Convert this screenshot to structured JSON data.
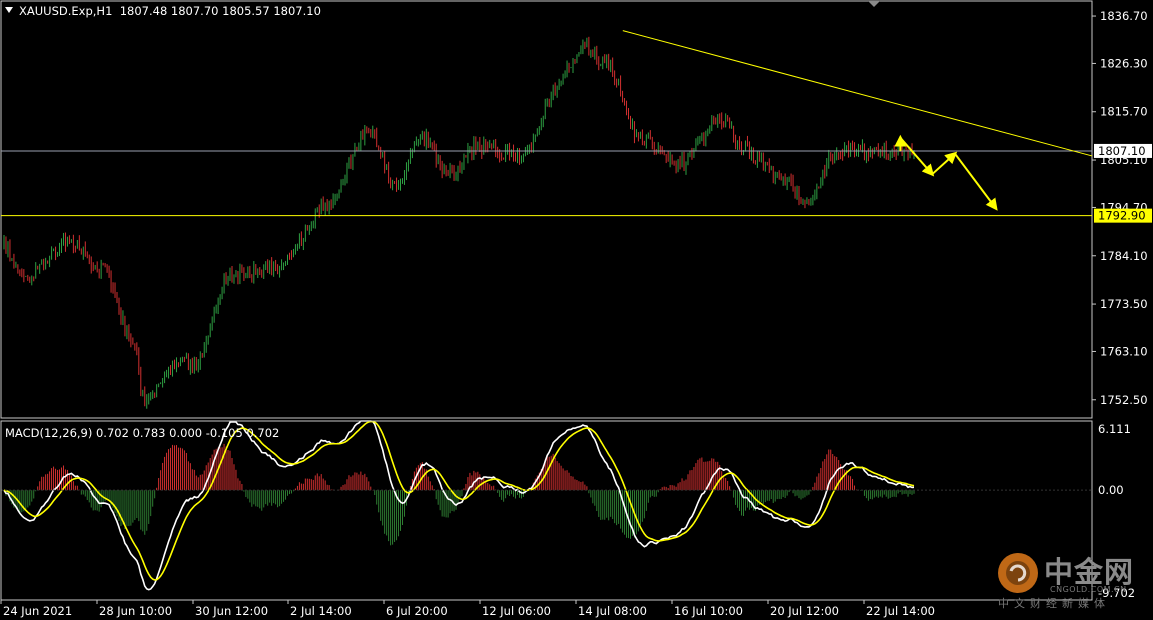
{
  "header": {
    "symbol": "XAUUSD.Exp,H1",
    "ohlc": "1807.48 1807.70 1805.57 1807.10"
  },
  "macd": {
    "label": "MACD(12,26,9) 0.702 0.783 0.000 -0.105 0.702",
    "axis_top": "6.111",
    "axis_zero": "0.00",
    "axis_bottom": "-9.702"
  },
  "watermark": {
    "main": "中金网",
    "url": "CNGOLD.COM.CN",
    "sub": "中文财经新媒体"
  },
  "colors": {
    "background": "#000000",
    "bull": "#2ea043",
    "bear": "#d23030",
    "line": "#ffff00",
    "current_price": "#9aa0b0",
    "macd_line": "#ffffff",
    "signal_line": "#ffff00",
    "hist_pos": "#d23030",
    "hist_neg": "#2e7d32"
  },
  "chart_data": [
    {
      "type": "candlestick",
      "symbol": "XAUUSD.Exp",
      "timeframe": "H1",
      "ylim": [
        1748.5,
        1840.0
      ],
      "y_ticks": [
        "1836.70",
        "1826.30",
        "1815.70",
        "1805.10",
        "1794.70",
        "1784.10",
        "1773.50",
        "1763.10",
        "1752.50"
      ],
      "x_ticks": [
        "24 Jun 2021",
        "28 Jun 10:00",
        "30 Jun 12:00",
        "2 Jul 14:00",
        "6 Jul 20:00",
        "12 Jul 06:00",
        "14 Jul 08:00",
        "16 Jul 10:00",
        "20 Jul 12:00",
        "22 Jul 14:00"
      ],
      "current_price": "1807.10",
      "support_level": "1792.90",
      "trendline": {
        "from_price": 1833.5,
        "to_price": 1806.0
      },
      "forecast_path": [
        1810.0,
        1802.0,
        1806.5,
        1794.5
      ],
      "anchors": [
        {
          "x": 0,
          "price": 1786.0
        },
        {
          "x": 0.02,
          "price": 1779.0
        },
        {
          "x": 0.07,
          "price": 1787.0
        },
        {
          "x": 0.11,
          "price": 1781.0
        },
        {
          "x": 0.14,
          "price": 1766.0
        },
        {
          "x": 0.155,
          "price": 1753.0
        },
        {
          "x": 0.19,
          "price": 1761.0
        },
        {
          "x": 0.21,
          "price": 1760.0
        },
        {
          "x": 0.25,
          "price": 1780.0
        },
        {
          "x": 0.3,
          "price": 1781.5
        },
        {
          "x": 0.36,
          "price": 1796.0
        },
        {
          "x": 0.4,
          "price": 1812.0
        },
        {
          "x": 0.43,
          "price": 1800.0
        },
        {
          "x": 0.46,
          "price": 1810.0
        },
        {
          "x": 0.49,
          "price": 1802.0
        },
        {
          "x": 0.52,
          "price": 1808.0
        },
        {
          "x": 0.57,
          "price": 1806.0
        },
        {
          "x": 0.61,
          "price": 1822.0
        },
        {
          "x": 0.635,
          "price": 1830.0
        },
        {
          "x": 0.66,
          "price": 1827.0
        },
        {
          "x": 0.7,
          "price": 1810.0
        },
        {
          "x": 0.74,
          "price": 1804.0
        },
        {
          "x": 0.79,
          "price": 1814.0
        },
        {
          "x": 0.81,
          "price": 1808.0
        },
        {
          "x": 0.85,
          "price": 1802.0
        },
        {
          "x": 0.885,
          "price": 1796.0
        },
        {
          "x": 0.91,
          "price": 1806.0
        },
        {
          "x": 0.93,
          "price": 1807.1
        }
      ],
      "candle_count": 460
    },
    {
      "type": "macd",
      "params": "12,26,9",
      "ylim": [
        -9.702,
        6.111
      ],
      "values": {
        "main": 0.702,
        "signal": 0.783,
        "hist": 0.0,
        "extra1": -0.105,
        "extra2": 0.702
      }
    }
  ]
}
